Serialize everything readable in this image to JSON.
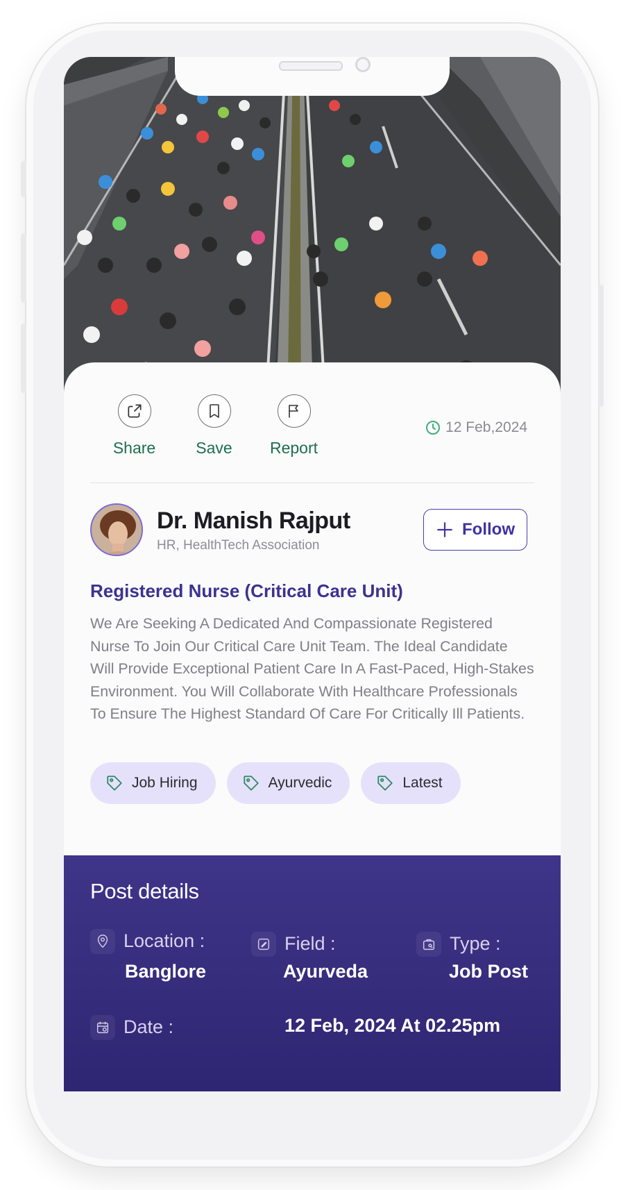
{
  "actions": {
    "share_label": "Share",
    "save_label": "Save",
    "report_label": "Report"
  },
  "post_date": "12 Feb,2024",
  "author": {
    "name": "Dr. Manish Rajput",
    "role": "HR, HealthTech Association",
    "follow_label": "Follow"
  },
  "job": {
    "title": "Registered Nurse (Critical Care Unit)",
    "description": "We Are Seeking A Dedicated And Compassionate Registered Nurse To Join Our Critical Care Unit Team. The Ideal Candidate Will Provide Exceptional Patient Care In A Fast-Paced, High-Stakes Environment. You Will Collaborate With Healthcare Professionals To Ensure The Highest Standard Of Care For Critically Ill Patients."
  },
  "tags": [
    "Job Hiring",
    "Ayurvedic",
    "Latest"
  ],
  "post_details": {
    "heading": "Post details",
    "location_label": "Location :",
    "location_value": "Banglore",
    "field_label": "Field :",
    "field_value": "Ayurveda",
    "type_label": "Type :",
    "type_value": "Job Post",
    "date_label": "Date :",
    "date_value": "12 Feb, 2024 At 02.25pm"
  },
  "colors": {
    "accent": "#3b3290",
    "action_green": "#1f6d4f",
    "tag_bg": "#e6e1fb",
    "details_bg": "#3f3589"
  }
}
